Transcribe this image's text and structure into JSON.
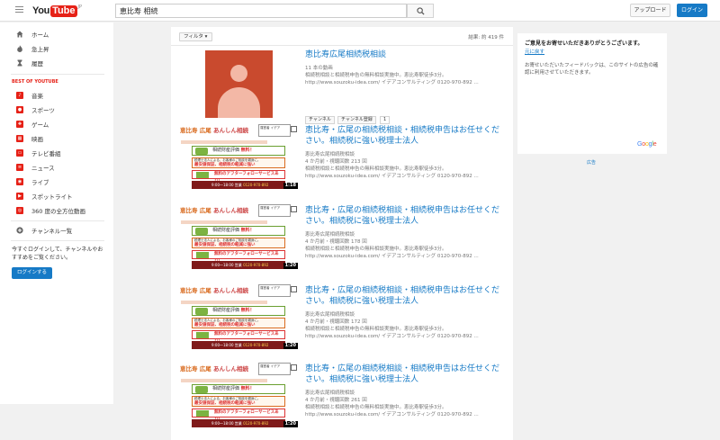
{
  "header": {
    "logo_text_you": "You",
    "logo_text_tube": "Tube",
    "logo_region": "JP",
    "search_query": "恵比寿 相続",
    "upload_label": "アップロード",
    "login_label": "ログイン"
  },
  "sidebar": {
    "main_items": [
      {
        "label": "ホーム",
        "icon": "home-icon"
      },
      {
        "label": "急上昇",
        "icon": "flame-icon"
      },
      {
        "label": "履歴",
        "icon": "hourglass-icon"
      }
    ],
    "best_title": "BEST OF YOUTUBE",
    "best_items": [
      {
        "label": "音楽",
        "icon": "music-icon"
      },
      {
        "label": "スポーツ",
        "icon": "sports-icon"
      },
      {
        "label": "ゲーム",
        "icon": "game-icon"
      },
      {
        "label": "映画",
        "icon": "movie-icon"
      },
      {
        "label": "テレビ番組",
        "icon": "tv-icon"
      },
      {
        "label": "ニュース",
        "icon": "news-icon"
      },
      {
        "label": "ライブ",
        "icon": "live-icon"
      },
      {
        "label": "スポットライト",
        "icon": "spotlight-icon"
      },
      {
        "label": "360 度の全方位動画",
        "icon": "360-video-icon"
      }
    ],
    "channel_list_label": "チャンネル一覧",
    "login_prompt": "今すぐログインして、チャンネルやおすすめをご覧ください。",
    "login_button": "ログインする"
  },
  "results": {
    "filter_label": "フィルタ ▾",
    "count_text": "結果: 約 419 件",
    "channel": {
      "title": "恵比寿広尾相続税相談",
      "video_count": "11 本の動画",
      "desc_line1": "相続税相談と相続税申告の無料相談実施中。恵比寿駅徒歩3分。",
      "desc_line2": "http://www.souzoku-idea.com/ イデアコンサルティング 0120-970-892 ...",
      "channel_button": "チャンネル",
      "subscribe_button": "チャンネル登録",
      "subscriber_count": "1"
    },
    "videos": [
      {
        "title": "恵比寿・広尾の相続税相談・相続税申告はお任せください。相続税に強い税理士法人",
        "channel": "恵比寿広尾相続税相談",
        "meta": "4 か月前・視聴回数 213 回",
        "desc_line1": "相続税相談と相続税申告の無料相談実施中。恵比寿駅徒歩3分。",
        "desc_line2": "http://www.souzoku-idea.com/ イデアコンサルティング 0120-970-892 ...",
        "duration": "1:18"
      },
      {
        "title": "恵比寿・広尾の相続税相談・相続税申告はお任せください。相続税に強い税理士法人",
        "channel": "恵比寿広尾相続税相談",
        "meta": "4 か月前・視聴回数 178 回",
        "desc_line1": "相続税相談と相続税申告の無料相談実施中。恵比寿駅徒歩3分。",
        "desc_line2": "http://www.souzoku-idea.com/ イデアコンサルティング 0120-970-892 ...",
        "duration": "1:20"
      },
      {
        "title": "恵比寿・広尾の相続税相談・相続税申告はお任せください。相続税に強い税理士法人",
        "channel": "恵比寿広尾相続税相談",
        "meta": "4 か月前・視聴回数 172 回",
        "desc_line1": "相続税相談と相続税申告の無料相談実施中。恵比寿駅徒歩3分。",
        "desc_line2": "http://www.souzoku-idea.com/ イデアコンサルティング 0120-970-892 ...",
        "duration": "1:20"
      },
      {
        "title": "恵比寿・広尾の相続税相談・相続税申告はお任せください。相続税に強い税理士法人",
        "channel": "恵比寿広尾相続税相談",
        "meta": "4 か月前・視聴回数 261 回",
        "desc_line1": "相続税相談と相続税申告の無料相談実施中。恵比寿駅徒歩3分。",
        "desc_line2": "http://www.souzoku-idea.com/ イデアコンサルティング 0120-970-892 ...",
        "duration": "1:20"
      }
    ],
    "thumb_banner": {
      "title_a": "恵比寿",
      "title_b": "広尾",
      "title_c": "あんしん相続",
      "sub_box": "運営者 イデア",
      "box1_label": "相続財産評価",
      "box1_hl": "無料！",
      "box2_line1": "税理士法人による、お客様のご相談を親身に。",
      "box2_line2": "最安値保証、相続税の軽減に強い",
      "box3_text": "無料のアフターフォローサービスあり！",
      "box4_hours": "9:00～18:00 営業",
      "box4_tel": "0120-970-892"
    }
  },
  "ad": {
    "heading": "ご意見をお寄せいただきありがとうございます。",
    "undo_link": "元に戻す",
    "body": "お寄せいただいたフィードバックは、このサイトの広告の確認に利用させていただきます。",
    "brand_name": "Google",
    "brand_colors": [
      "#4285f4",
      "#ea4335",
      "#fbbc05",
      "#4285f4",
      "#34a853",
      "#ea4335"
    ],
    "footer_label": "広告"
  },
  "colors": {
    "accent": "#e62117",
    "link": "#167ac6",
    "login_blue": "#167ac6"
  }
}
